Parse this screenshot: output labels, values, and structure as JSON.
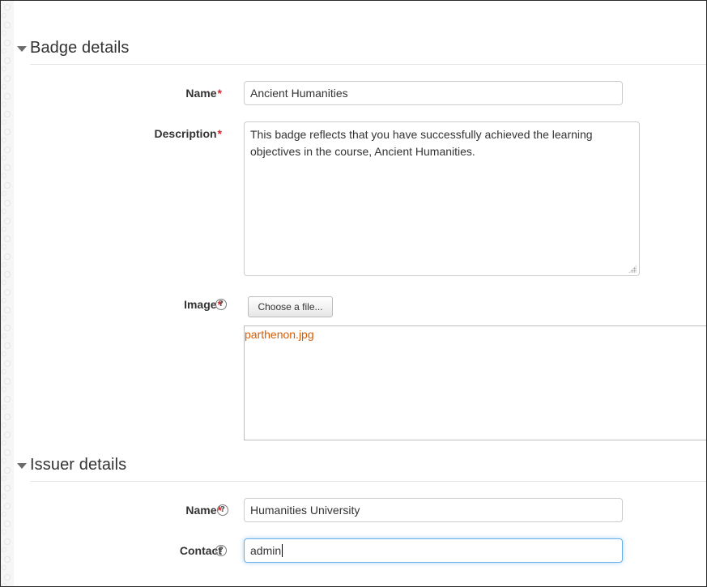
{
  "badge_details": {
    "section_title": "Badge details",
    "name": {
      "label": "Name",
      "required_mark": "*",
      "value": "Ancient Humanities"
    },
    "description": {
      "label": "Description",
      "required_mark": "*",
      "value": "This badge reflects that you have successfully achieved the learning objectives in the course, Ancient Humanities."
    },
    "image": {
      "label": "Image",
      "required_mark": "*",
      "help_glyph": "?",
      "choose_button": "Choose a file...",
      "file_name": "parthenon.jpg"
    }
  },
  "issuer_details": {
    "section_title": "Issuer details",
    "name": {
      "label": "Name",
      "required_mark": "*",
      "help_glyph": "?",
      "value": "Humanities University"
    },
    "contact": {
      "label": "Contact",
      "help_glyph": "?",
      "value": "admin"
    }
  },
  "colors": {
    "required": "#d6252b",
    "file_link": "#d95c00",
    "focus_border": "#66afe9"
  }
}
